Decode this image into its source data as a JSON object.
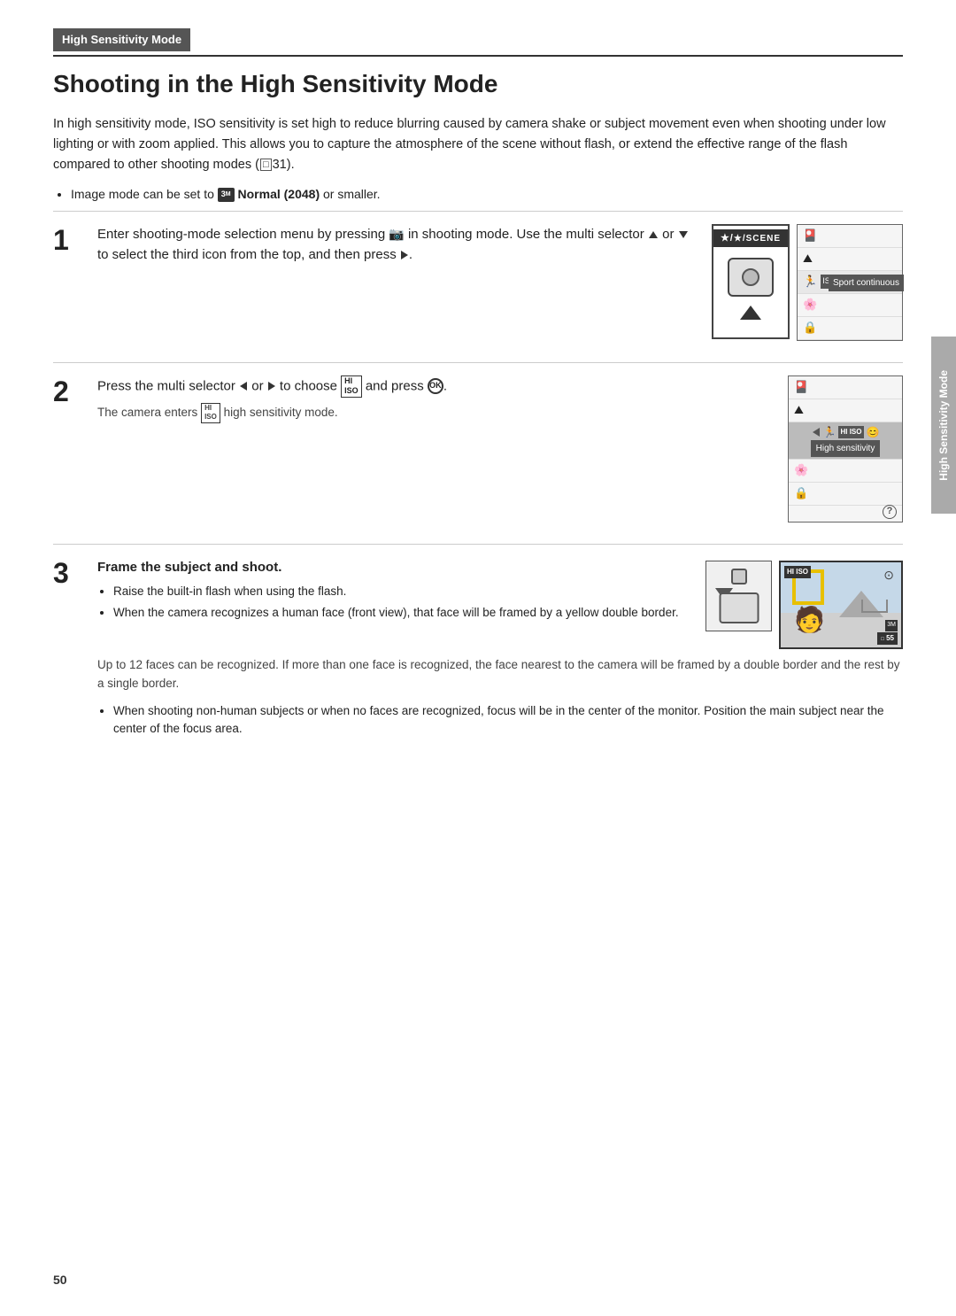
{
  "header": {
    "section_label": "High Sensitivity Mode"
  },
  "page_title": "Shooting in the High Sensitivity Mode",
  "intro": "In high sensitivity mode, ISO sensitivity is set high to reduce blurring caused by camera shake or subject movement even when shooting under low lighting or with zoom applied. This allows you to capture the atmosphere of the scene without flash, or extend the effective range of the flash compared to other shooting modes (",
  "intro_ref": "31",
  "intro_end": ").",
  "image_mode_bullet": "Image mode can be set to",
  "image_mode_bold": "Normal (2048)",
  "image_mode_end": "or smaller.",
  "steps": [
    {
      "number": "1",
      "title": "Enter shooting-mode selection menu by pressing",
      "title_mid": "in shooting mode. Use the multi selector",
      "title_mid2": "or",
      "title_mid3": "to select the third icon from the top, and then press",
      "title_end": ".",
      "diagram_label": "SCENE",
      "panel_label": "Sport continuous"
    },
    {
      "number": "2",
      "title": "Press the multi selector",
      "title_mid": "or",
      "title_mid2": "to choose",
      "title_mid3": "and press",
      "title_end": ".",
      "sub_desc": "The camera enters",
      "sub_desc_end": "high sensitivity mode.",
      "panel_label": "High sensitivity"
    },
    {
      "number": "3",
      "title": "Frame the subject and shoot.",
      "bullets": [
        "Raise the built-in flash when using the flash.",
        "When the camera recognizes a human face (front view), that face will be framed by a yellow double border."
      ],
      "extra_text": "Up to 12 faces can be recognized. If more than one face is recognized, the face nearest to the camera will be framed by a double border and the rest by a single border.",
      "final_bullet": "When shooting non-human subjects or when no faces are recognized, focus will be in the center of the monitor. Position the main subject near the center of the focus area."
    }
  ],
  "page_number": "50",
  "side_label": "High Sensitivity Mode",
  "icons": {
    "scene_top": "★/SCENE",
    "hi_iso": "HI ISO",
    "normal_3m": "3M",
    "count_55": "55"
  }
}
